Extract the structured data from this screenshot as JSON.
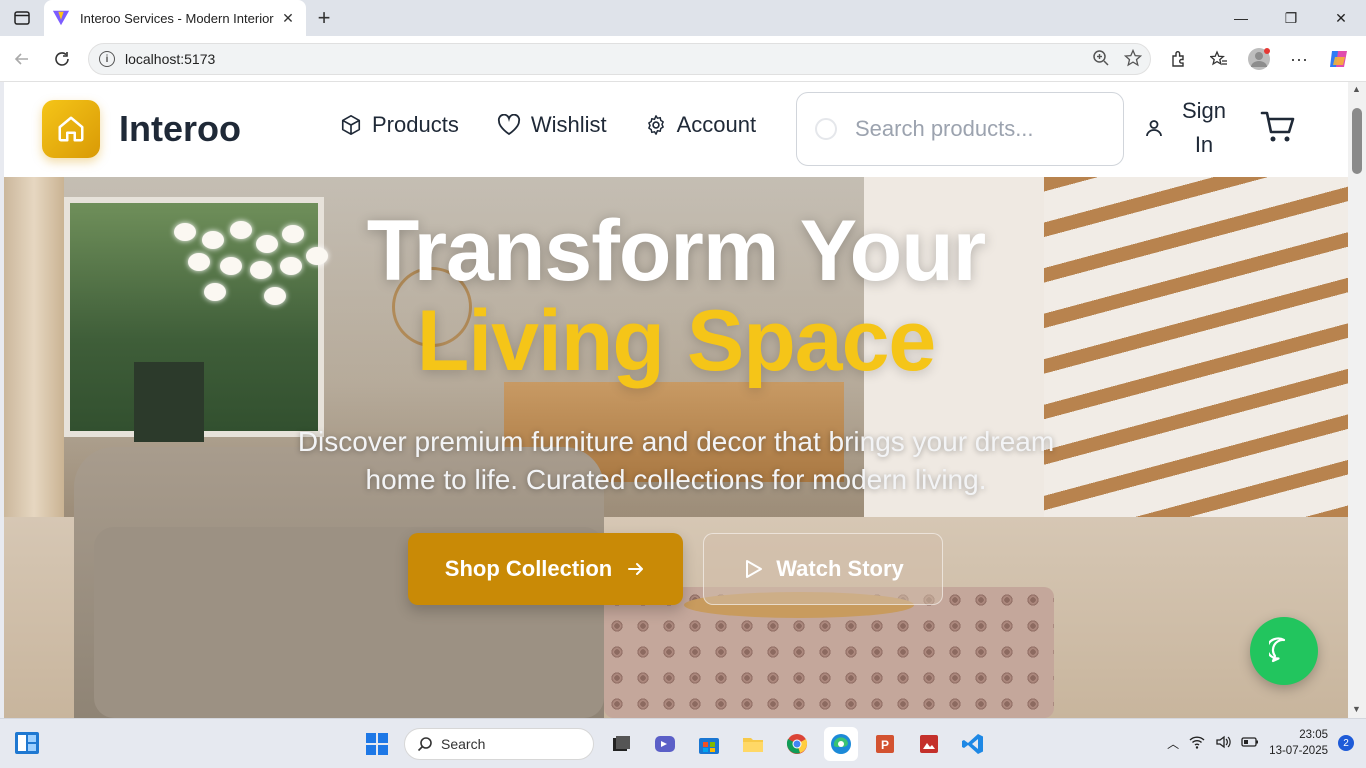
{
  "browser": {
    "tab_title": "Interoo Services - Modern Interior",
    "url": "localhost:5173"
  },
  "nav": {
    "brand": "Interoo",
    "links": [
      {
        "label": "Products",
        "icon": "box-icon"
      },
      {
        "label": "Wishlist",
        "icon": "heart-icon"
      },
      {
        "label": "Account",
        "icon": "gear-icon"
      }
    ],
    "search_placeholder": "Search products...",
    "signin_line1": "Sign",
    "signin_line2": "In"
  },
  "hero": {
    "title_line1": "Transform Your",
    "title_line2": "Living Space",
    "subtitle": "Discover premium furniture and decor that brings your dream home to life. Curated collections for modern living.",
    "primary_button": "Shop Collection",
    "secondary_button": "Watch Story"
  },
  "colors": {
    "accent": "#f5c518",
    "primary_button": "#c98a06",
    "chat": "#22c55e"
  },
  "taskbar": {
    "search_label": "Search",
    "time": "23:05",
    "date": "13-07-2025",
    "notification_count": "2"
  }
}
